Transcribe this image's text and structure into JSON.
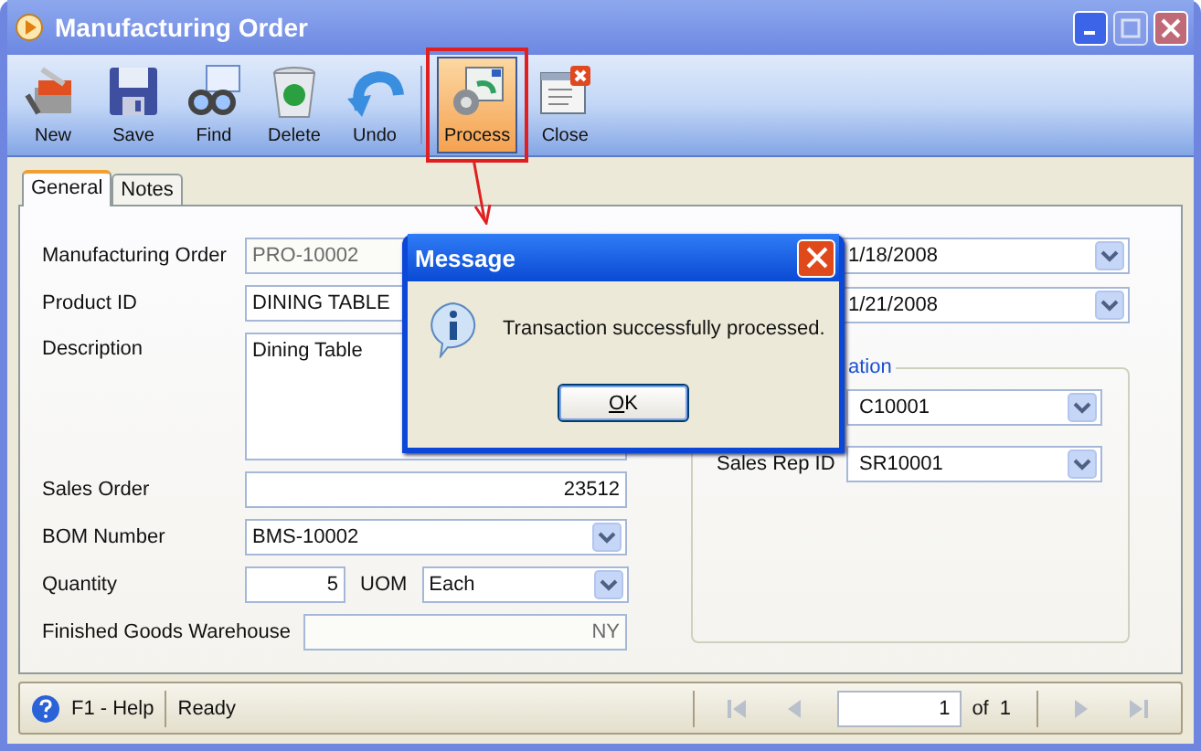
{
  "window": {
    "title": "Manufacturing Order"
  },
  "toolbar": [
    {
      "label": "New",
      "kind": "new",
      "selected": false
    },
    {
      "label": "Save",
      "kind": "save",
      "selected": false
    },
    {
      "label": "Find",
      "kind": "find",
      "selected": false
    },
    {
      "label": "Delete",
      "kind": "delete",
      "selected": false
    },
    {
      "label": "Undo",
      "kind": "undo",
      "selected": false
    },
    {
      "label": "Process",
      "kind": "process",
      "selected": true
    },
    {
      "label": "Close",
      "kind": "close",
      "selected": false
    }
  ],
  "tabs": [
    {
      "label": "General",
      "selected": true
    },
    {
      "label": "Notes",
      "selected": false
    }
  ],
  "fields": [
    {
      "label": "Manufacturing Order",
      "value": "PRO-10002",
      "kind": "text",
      "disabled": true
    },
    {
      "label": "Product ID",
      "value": "DINING TABLE",
      "kind": "text",
      "disabled": false
    },
    {
      "label": "Description",
      "value": "Dining Table",
      "kind": "memo",
      "disabled": false
    },
    {
      "label": "Sales Order",
      "value": "23512",
      "kind": "number",
      "disabled": false
    },
    {
      "label": "BOM Number",
      "value": "BMS-10002",
      "kind": "combo",
      "disabled": false
    },
    {
      "label": "Quantity",
      "value": "5",
      "kind": "quantity",
      "disabled": false,
      "uom": {
        "label": "UOM",
        "value": "Each"
      }
    },
    {
      "label": "Finished Goods Warehouse",
      "value": "NY",
      "kind": "number",
      "disabled": true
    }
  ],
  "dates": [
    {
      "value": "1/18/2008"
    },
    {
      "value": "1/21/2008"
    }
  ],
  "group": {
    "legend": "ation",
    "fields": [
      {
        "value": "C10001"
      },
      {
        "label": "Sales Rep ID",
        "value": "SR10001"
      }
    ]
  },
  "dialog": {
    "title": "Message",
    "message": "Transaction successfully processed.",
    "button": "OK"
  },
  "status_bar": {
    "help": "F1 - Help",
    "status": "Ready",
    "page": "1",
    "of": "of",
    "total": "1"
  }
}
